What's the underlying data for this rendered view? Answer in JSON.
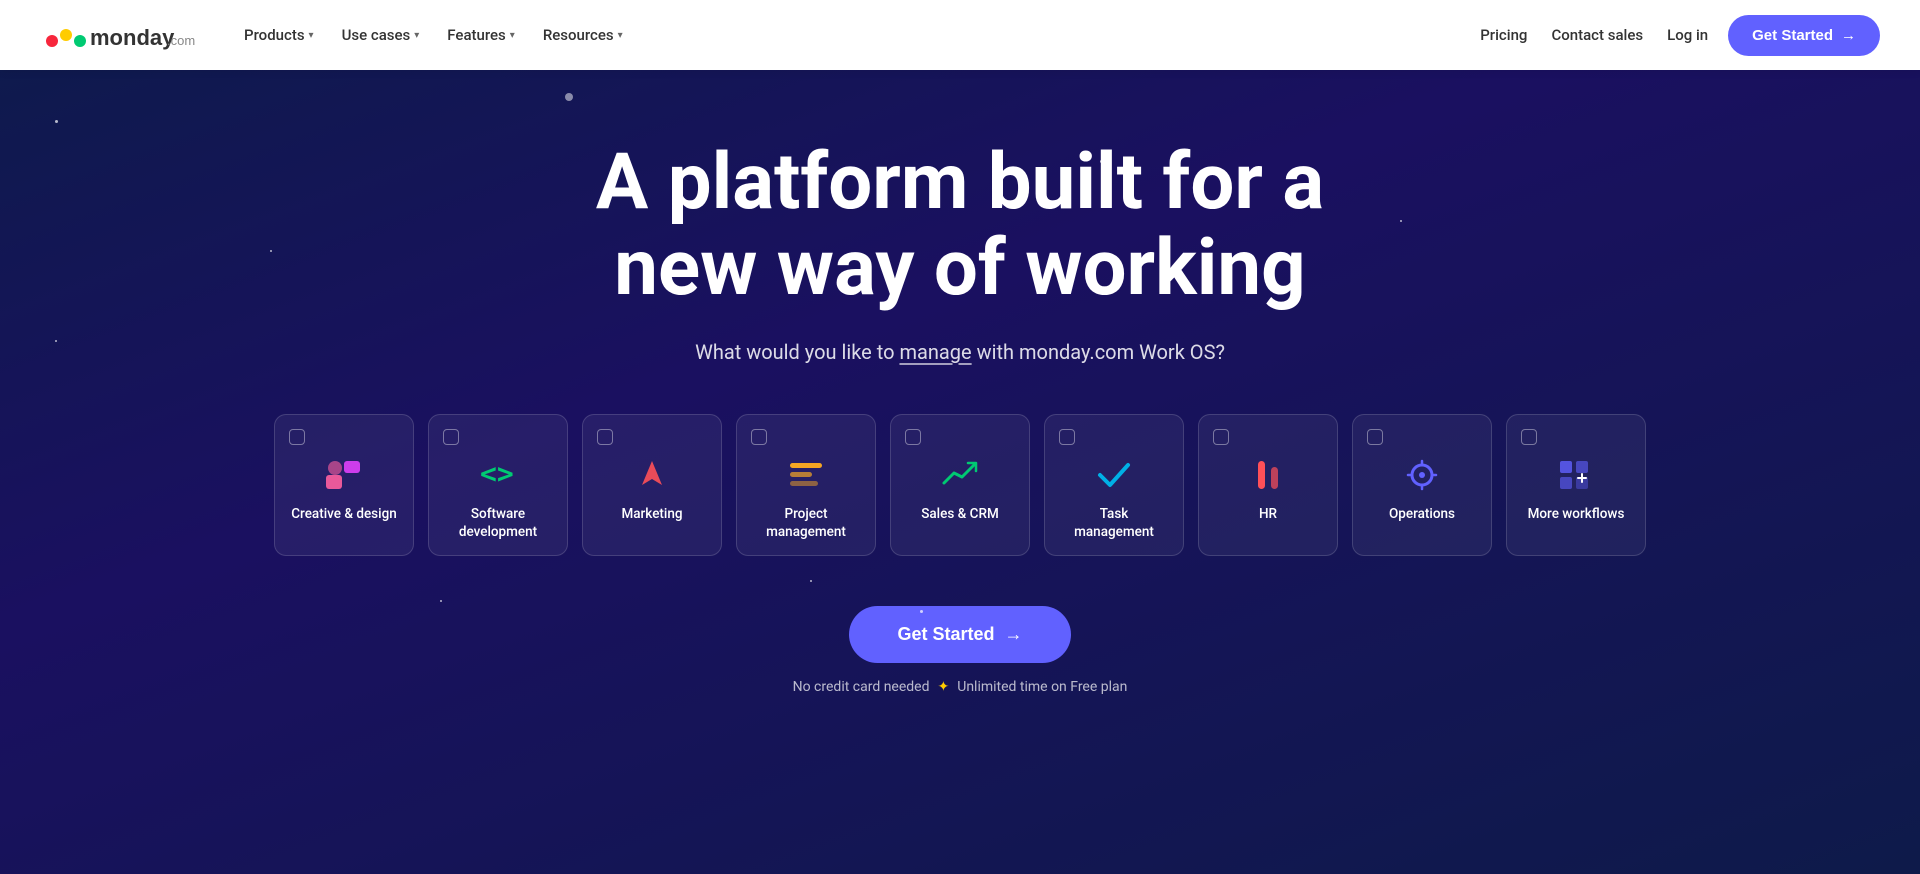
{
  "nav": {
    "logo_text": "monday.com",
    "links": [
      {
        "label": "Products",
        "has_dropdown": true
      },
      {
        "label": "Use cases",
        "has_dropdown": true
      },
      {
        "label": "Features",
        "has_dropdown": true
      },
      {
        "label": "Resources",
        "has_dropdown": true
      }
    ],
    "right_links": [
      {
        "label": "Pricing"
      },
      {
        "label": "Contact sales"
      },
      {
        "label": "Log in"
      }
    ],
    "cta_label": "Get Started",
    "cta_arrow": "→"
  },
  "hero": {
    "title_line1": "A platform built for a",
    "title_line2": "new way of working",
    "subtitle": "What would you like to manage with monday.com Work OS?",
    "subtitle_underline_word": "manage",
    "cta_label": "Get Started",
    "cta_arrow": "→",
    "cta_note": "No credit card needed",
    "cta_note_diamond": "✦",
    "cta_note_free": "Unlimited time on Free plan"
  },
  "workflow_cards": [
    {
      "id": "creative",
      "label": "Creative &\ndesign",
      "icon_type": "creative"
    },
    {
      "id": "software",
      "label": "Software\ndevelopment",
      "icon_type": "software"
    },
    {
      "id": "marketing",
      "label": "Marketing",
      "icon_type": "marketing"
    },
    {
      "id": "project",
      "label": "Project\nmanagement",
      "icon_type": "project"
    },
    {
      "id": "sales",
      "label": "Sales &\nCRM",
      "icon_type": "sales"
    },
    {
      "id": "task",
      "label": "Task\nmanagement",
      "icon_type": "task"
    },
    {
      "id": "hr",
      "label": "HR",
      "icon_type": "hr"
    },
    {
      "id": "operations",
      "label": "Operations",
      "icon_type": "operations"
    },
    {
      "id": "more",
      "label": "More\nworkflows",
      "icon_type": "more"
    }
  ],
  "colors": {
    "brand_purple": "#6161ff",
    "nav_bg": "#ffffff",
    "hero_bg_start": "#0d1b4b",
    "hero_bg_end": "#1a1060"
  }
}
